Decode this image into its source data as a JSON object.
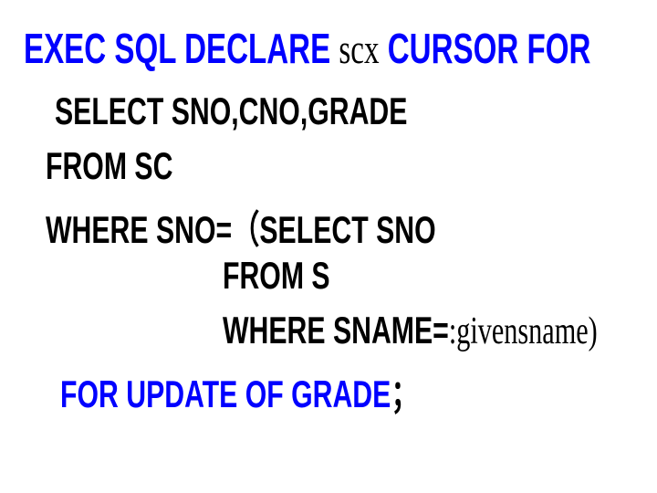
{
  "line1": {
    "a": "EXEC SQL DECLARE ",
    "b": "scx",
    "c": " CURSOR FOR"
  },
  "line2": "SELECT SNO,CNO,GRADE",
  "line3": "FROM SC",
  "line4": "WHERE SNO=（SELECT SNO",
  "line5": "FROM S",
  "line6a": "WHERE SNAME=",
  "line6b": ":givensname)",
  "line7a": "FOR UPDATE  OF  GRADE",
  "line7b": "；"
}
